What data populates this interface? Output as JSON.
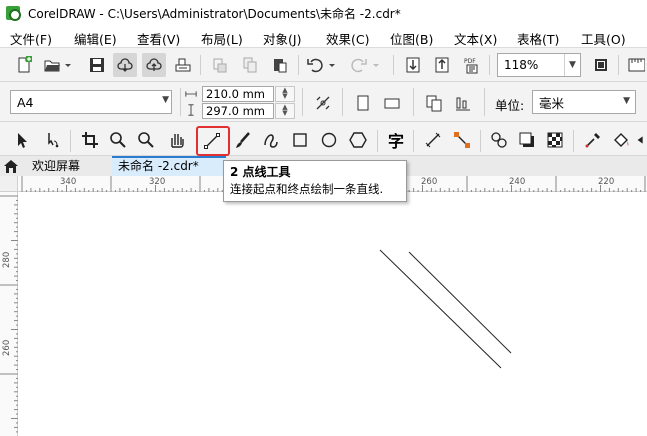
{
  "window": {
    "title": "CorelDRAW - C:\\Users\\Administrator\\Documents\\未命名 -2.cdr*"
  },
  "menu": [
    {
      "label": "文件(F)"
    },
    {
      "label": "编辑(E)"
    },
    {
      "label": "查看(V)"
    },
    {
      "label": "布局(L)"
    },
    {
      "label": "对象(J)"
    },
    {
      "label": "效果(C)"
    },
    {
      "label": "位图(B)"
    },
    {
      "label": "文本(X)"
    },
    {
      "label": "表格(T)"
    },
    {
      "label": "工具(O)"
    }
  ],
  "standard_toolbar": {
    "zoom_level": "118%",
    "pdf_label": "PDF"
  },
  "property_bar": {
    "page_size": "A4",
    "width": "210.0 mm",
    "height": "297.0 mm",
    "units_label": "单位:",
    "units_value": "毫米"
  },
  "toolbox": {
    "text_tool_glyph": "字",
    "highlighted_tool": "2-point-line-tool"
  },
  "tabs": [
    {
      "label": "欢迎屏幕",
      "active": false
    },
    {
      "label": "未命名 -2.cdr*",
      "active": true
    }
  ],
  "ruler": {
    "horizontal_labels": [
      "340",
      "320",
      "260",
      "240",
      "220"
    ],
    "vertical_labels": [
      "280",
      "260"
    ]
  },
  "tooltip": {
    "title": "2 点线工具",
    "description": "连接起点和终点绘制一条直线."
  },
  "colors": {
    "highlight_border": "#e03030",
    "active_tab_bg": "#d9ecfb",
    "accent_blue": "#2b7bd1",
    "app_logo": "#3aa03a"
  }
}
